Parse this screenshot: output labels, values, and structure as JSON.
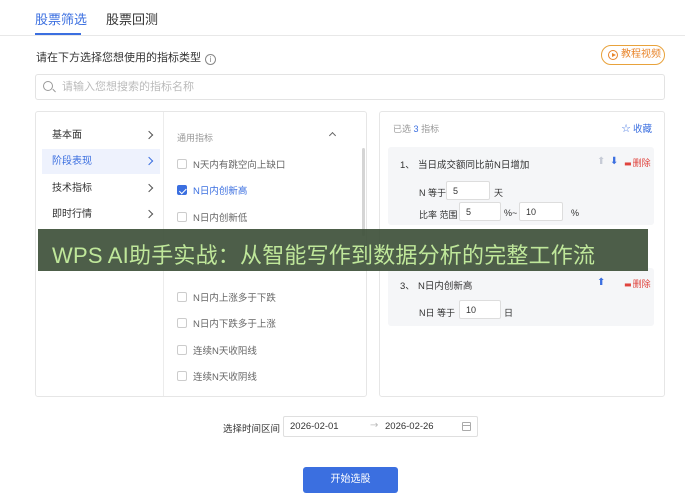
{
  "tabs": [
    {
      "label": "股票筛选",
      "active": true
    },
    {
      "label": "股票回测",
      "active": false
    }
  ],
  "prompt": "请在下方选择您想使用的指标类型",
  "video_button": "教程视频",
  "search": {
    "placeholder": "请输入您想搜索的指标名称"
  },
  "categories": [
    {
      "label": "基本面",
      "active": false
    },
    {
      "label": "阶段表现",
      "active": true
    },
    {
      "label": "技术指标",
      "active": false
    },
    {
      "label": "即时行情",
      "active": false
    }
  ],
  "indicators": {
    "header": "通用指标",
    "items": [
      {
        "label": "N天内有跳空向上缺口",
        "checked": false
      },
      {
        "label": "N日内创新高",
        "checked": true
      },
      {
        "label": "N日内创新低",
        "checked": false
      },
      {
        "label": "N日内上涨多于下跌",
        "checked": false
      },
      {
        "label": "N日内下跌多于上涨",
        "checked": false
      },
      {
        "label": "连续N天收阳线",
        "checked": false
      },
      {
        "label": "连续N天收阴线",
        "checked": false
      }
    ]
  },
  "selected": {
    "prefix": "已选",
    "count": "3",
    "suffix": "指标",
    "favorite": "收藏",
    "delete_label": "删除",
    "cards": [
      {
        "num": "1、",
        "title": "当日成交额同比前N日增加",
        "n_label": "N 等于",
        "n_value": "5",
        "n_unit": "天",
        "ratio_label": "比率 范围",
        "ratio_min": "5",
        "ratio_sep": "%~",
        "ratio_max": "10",
        "ratio_unit": "%"
      },
      {
        "num": "3、",
        "title": "N日内创新高",
        "n_label": "N日 等于",
        "n_value": "10",
        "n_unit": "日"
      }
    ]
  },
  "banner": "WPS AI助手实战：从智能写作到数据分析的完整工作流",
  "date": {
    "label": "选择时间区间",
    "start": "2026-02-01",
    "end": "2026-02-26"
  },
  "start_button": "开始选股",
  "colors": {
    "accent": "#3b6fe0",
    "danger": "#e0443e",
    "video": "#e8852b",
    "banner_text": "#bfe79a"
  }
}
